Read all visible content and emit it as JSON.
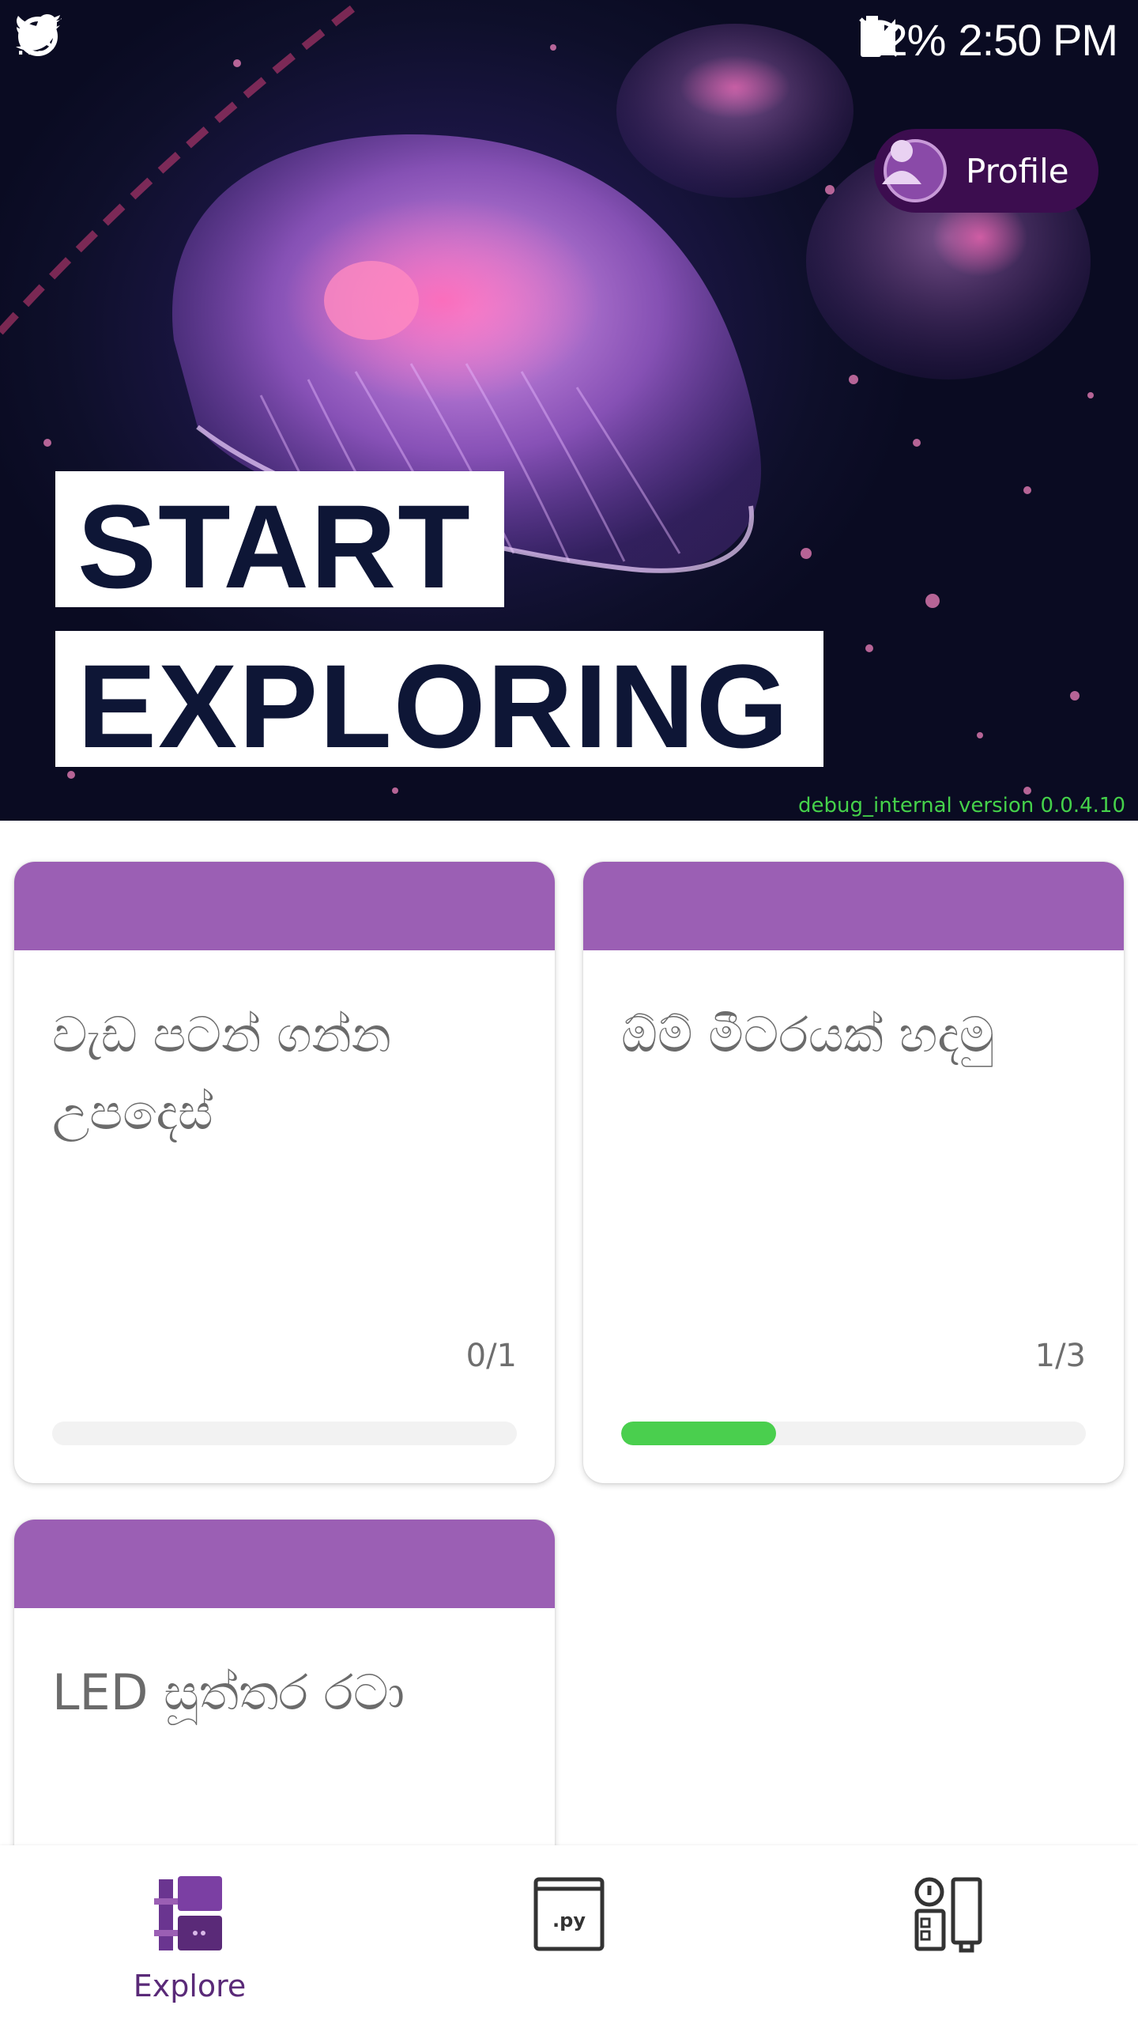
{
  "status_bar": {
    "left_icons": [
      "sync-icon",
      "twitter-icon",
      "bird-icon"
    ],
    "overflow": "...",
    "right_icons": [
      "battery-saver-icon",
      "bluetooth-icon",
      "mute-icon",
      "wifi-icon",
      "signal-icon"
    ],
    "battery": "82%",
    "time": "2:50 PM"
  },
  "hero": {
    "profile_label": "Profile",
    "headline_line1": "START",
    "headline_line2": "EXPLORING",
    "debug_text": "debug_internal version 0.0.4.10"
  },
  "cards": [
    {
      "title": "වැඩ පටන් ගන්න උපදෙස්",
      "count": "0/1",
      "progress": 0.0,
      "accent": "#9b5fb4"
    },
    {
      "title": "ඕම් මීටරයක් හදමු",
      "count": "1/3",
      "progress": 0.333,
      "accent": "#9b5fb4"
    },
    {
      "title": "LED සූත්තර රටා",
      "accent": "#9b5fb4"
    }
  ],
  "bottom_nav": {
    "items": [
      {
        "label": "Explore",
        "icon": "explore-icon",
        "active": true
      },
      {
        "label": "",
        "icon": "python-file-icon",
        "active": false
      },
      {
        "label": "",
        "icon": "devices-icon",
        "active": false
      }
    ]
  },
  "colors": {
    "accent_purple": "#9b5fb4",
    "progress_green": "#4acf4e",
    "nav_active": "#5a2a78",
    "debug_green": "#45d14a"
  }
}
